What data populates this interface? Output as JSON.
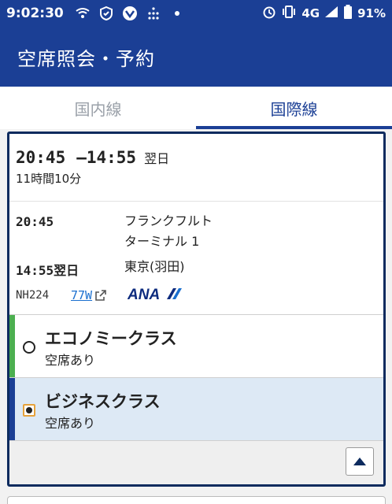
{
  "status_bar": {
    "time": "9:02:30",
    "network": "4G",
    "battery": "91%",
    "icons": [
      "wifi-calling-icon",
      "shield-icon",
      "vpn-icon",
      "grid-icon",
      "dot-icon",
      "alarm-icon",
      "vibrate-icon",
      "signal-icon",
      "battery-icon"
    ]
  },
  "header": {
    "title": "空席照会・予約"
  },
  "tabs": [
    {
      "label": "国内線",
      "active": false
    },
    {
      "label": "国際線",
      "active": true
    }
  ],
  "flight": {
    "depart_time": "20:45",
    "arrive_time": "—14:55",
    "next_day": "翌日",
    "duration": "11時間10分",
    "segment": {
      "dep_time": "20:45",
      "dep_place_line1": "フランクフルト",
      "dep_place_line2": "ターミナル 1",
      "arr_time": "14:55翌日",
      "arr_place": "東京(羽田)"
    },
    "flight_number": "NH224",
    "aircraft": "77W",
    "airline_logo_text": "ANA"
  },
  "fares": [
    {
      "name": "エコノミークラス",
      "availability": "空席あり",
      "selected": false,
      "accent": "#4caf50"
    },
    {
      "name": "ビジネスクラス",
      "availability": "空席あり",
      "selected": true,
      "accent": "#1b3f95"
    }
  ],
  "colors": {
    "primary": "#1b3f95",
    "link": "#1a6fcf",
    "selected_bg": "#dde9f5"
  }
}
